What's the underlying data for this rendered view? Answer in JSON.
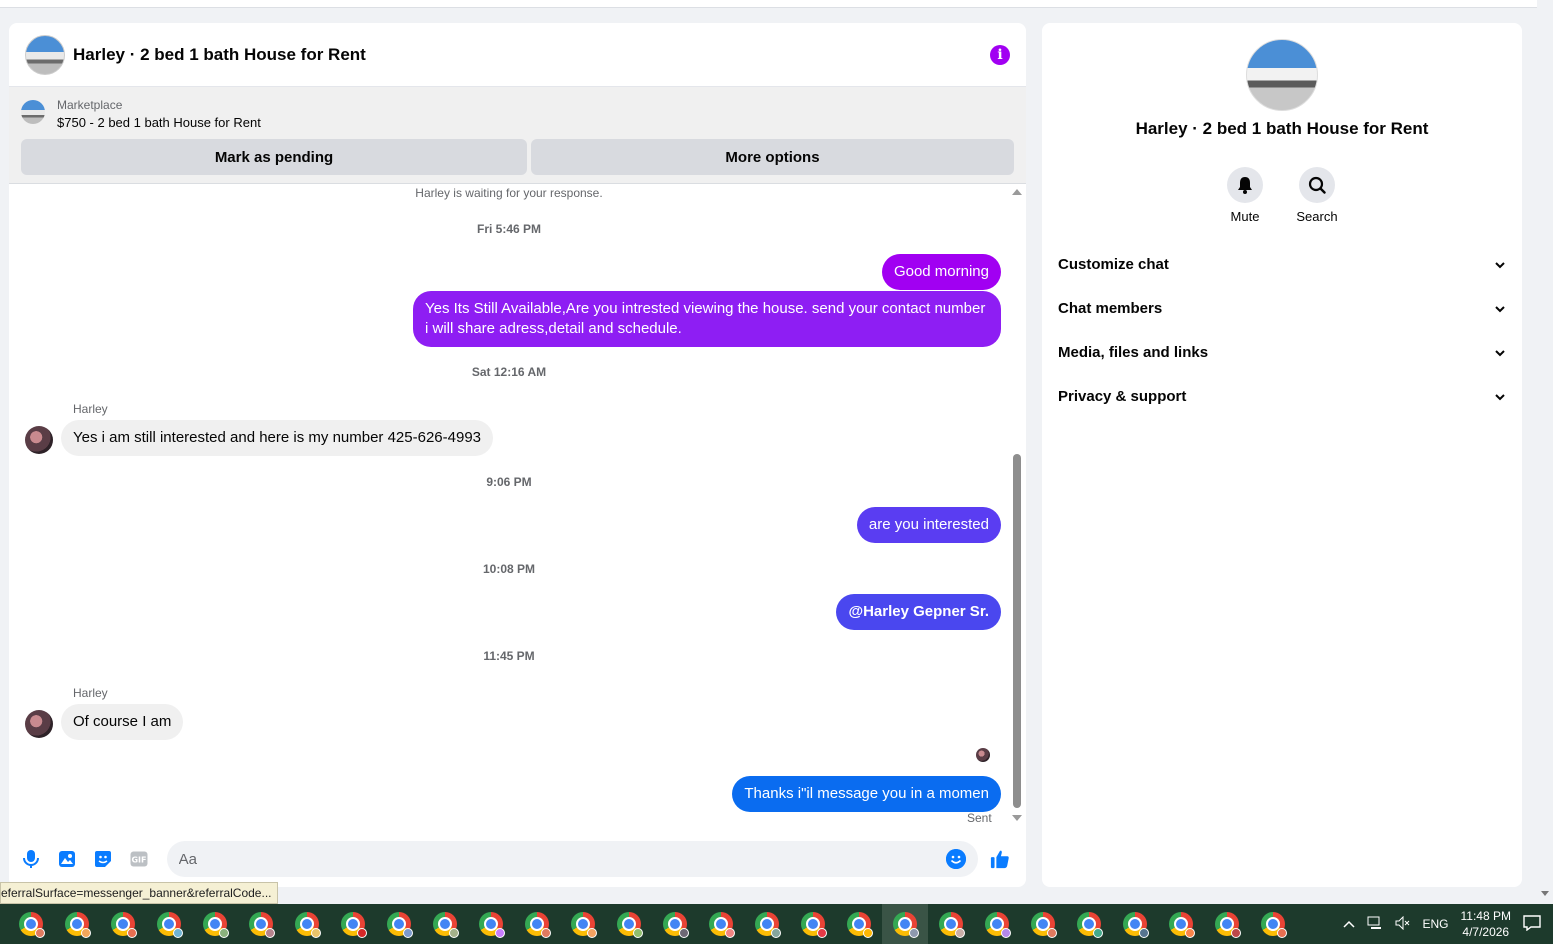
{
  "chat": {
    "title": "Harley · 2 bed 1 bath House for Rent",
    "marketplace_label": "Marketplace",
    "listing": "$750 - 2 bed 1 bath House for Rent",
    "btn_pending": "Mark as pending",
    "btn_more": "More options",
    "waiting": "Harley is waiting for your response.",
    "composer_placeholder": "Aa"
  },
  "messages": {
    "ts1": "Fri 5:46 PM",
    "m1": "Good morning",
    "m2": "Yes Its Still Available,Are you intrested viewing the house. send your contact number i will share adress,detail and schedule.",
    "ts2": "Sat 12:16 AM",
    "sender1": "Harley",
    "m3": "Yes i am still interested and here is my number 425-626-4993",
    "ts3": "9:06 PM",
    "m4": "are you interested",
    "ts4": "10:08 PM",
    "m5": "@Harley Gepner Sr.",
    "ts5": "11:45 PM",
    "sender2": "Harley",
    "m6": "Of course I am",
    "m7": "Thanks i\"il message you in a momen",
    "sent": "Sent"
  },
  "colors": {
    "purple": "#a100f2",
    "violet": "#5a3df2",
    "indigo": "#4a47ef",
    "blue": "#0a6cf0"
  },
  "info": {
    "title": "Harley · 2 bed 1 bath House for Rent",
    "mute": "Mute",
    "search": "Search",
    "sections": [
      "Customize chat",
      "Chat members",
      "Media, files and links",
      "Privacy & support"
    ]
  },
  "statusbar": {
    "url": "eferralSurface=messenger_banner&referralCode..."
  },
  "taskbar": {
    "lang": "ENG",
    "time": "11:48 PM",
    "date": "4/7/2026"
  }
}
